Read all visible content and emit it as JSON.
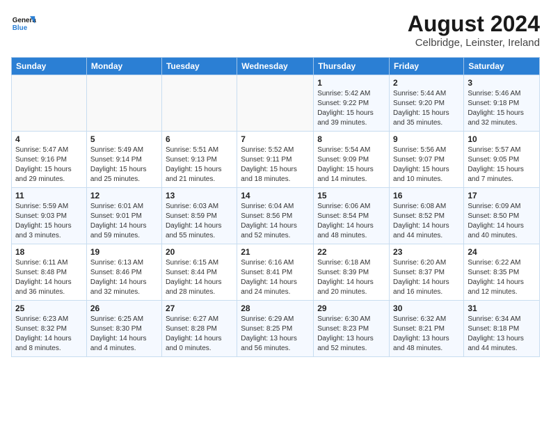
{
  "header": {
    "logo_general": "General",
    "logo_blue": "Blue",
    "month_year": "August 2024",
    "location": "Celbridge, Leinster, Ireland"
  },
  "days_of_week": [
    "Sunday",
    "Monday",
    "Tuesday",
    "Wednesday",
    "Thursday",
    "Friday",
    "Saturday"
  ],
  "weeks": [
    [
      {
        "day": "",
        "info": ""
      },
      {
        "day": "",
        "info": ""
      },
      {
        "day": "",
        "info": ""
      },
      {
        "day": "",
        "info": ""
      },
      {
        "day": "1",
        "info": "Sunrise: 5:42 AM\nSunset: 9:22 PM\nDaylight: 15 hours\nand 39 minutes."
      },
      {
        "day": "2",
        "info": "Sunrise: 5:44 AM\nSunset: 9:20 PM\nDaylight: 15 hours\nand 35 minutes."
      },
      {
        "day": "3",
        "info": "Sunrise: 5:46 AM\nSunset: 9:18 PM\nDaylight: 15 hours\nand 32 minutes."
      }
    ],
    [
      {
        "day": "4",
        "info": "Sunrise: 5:47 AM\nSunset: 9:16 PM\nDaylight: 15 hours\nand 29 minutes."
      },
      {
        "day": "5",
        "info": "Sunrise: 5:49 AM\nSunset: 9:14 PM\nDaylight: 15 hours\nand 25 minutes."
      },
      {
        "day": "6",
        "info": "Sunrise: 5:51 AM\nSunset: 9:13 PM\nDaylight: 15 hours\nand 21 minutes."
      },
      {
        "day": "7",
        "info": "Sunrise: 5:52 AM\nSunset: 9:11 PM\nDaylight: 15 hours\nand 18 minutes."
      },
      {
        "day": "8",
        "info": "Sunrise: 5:54 AM\nSunset: 9:09 PM\nDaylight: 15 hours\nand 14 minutes."
      },
      {
        "day": "9",
        "info": "Sunrise: 5:56 AM\nSunset: 9:07 PM\nDaylight: 15 hours\nand 10 minutes."
      },
      {
        "day": "10",
        "info": "Sunrise: 5:57 AM\nSunset: 9:05 PM\nDaylight: 15 hours\nand 7 minutes."
      }
    ],
    [
      {
        "day": "11",
        "info": "Sunrise: 5:59 AM\nSunset: 9:03 PM\nDaylight: 15 hours\nand 3 minutes."
      },
      {
        "day": "12",
        "info": "Sunrise: 6:01 AM\nSunset: 9:01 PM\nDaylight: 14 hours\nand 59 minutes."
      },
      {
        "day": "13",
        "info": "Sunrise: 6:03 AM\nSunset: 8:59 PM\nDaylight: 14 hours\nand 55 minutes."
      },
      {
        "day": "14",
        "info": "Sunrise: 6:04 AM\nSunset: 8:56 PM\nDaylight: 14 hours\nand 52 minutes."
      },
      {
        "day": "15",
        "info": "Sunrise: 6:06 AM\nSunset: 8:54 PM\nDaylight: 14 hours\nand 48 minutes."
      },
      {
        "day": "16",
        "info": "Sunrise: 6:08 AM\nSunset: 8:52 PM\nDaylight: 14 hours\nand 44 minutes."
      },
      {
        "day": "17",
        "info": "Sunrise: 6:09 AM\nSunset: 8:50 PM\nDaylight: 14 hours\nand 40 minutes."
      }
    ],
    [
      {
        "day": "18",
        "info": "Sunrise: 6:11 AM\nSunset: 8:48 PM\nDaylight: 14 hours\nand 36 minutes."
      },
      {
        "day": "19",
        "info": "Sunrise: 6:13 AM\nSunset: 8:46 PM\nDaylight: 14 hours\nand 32 minutes."
      },
      {
        "day": "20",
        "info": "Sunrise: 6:15 AM\nSunset: 8:44 PM\nDaylight: 14 hours\nand 28 minutes."
      },
      {
        "day": "21",
        "info": "Sunrise: 6:16 AM\nSunset: 8:41 PM\nDaylight: 14 hours\nand 24 minutes."
      },
      {
        "day": "22",
        "info": "Sunrise: 6:18 AM\nSunset: 8:39 PM\nDaylight: 14 hours\nand 20 minutes."
      },
      {
        "day": "23",
        "info": "Sunrise: 6:20 AM\nSunset: 8:37 PM\nDaylight: 14 hours\nand 16 minutes."
      },
      {
        "day": "24",
        "info": "Sunrise: 6:22 AM\nSunset: 8:35 PM\nDaylight: 14 hours\nand 12 minutes."
      }
    ],
    [
      {
        "day": "25",
        "info": "Sunrise: 6:23 AM\nSunset: 8:32 PM\nDaylight: 14 hours\nand 8 minutes."
      },
      {
        "day": "26",
        "info": "Sunrise: 6:25 AM\nSunset: 8:30 PM\nDaylight: 14 hours\nand 4 minutes."
      },
      {
        "day": "27",
        "info": "Sunrise: 6:27 AM\nSunset: 8:28 PM\nDaylight: 14 hours\nand 0 minutes."
      },
      {
        "day": "28",
        "info": "Sunrise: 6:29 AM\nSunset: 8:25 PM\nDaylight: 13 hours\nand 56 minutes."
      },
      {
        "day": "29",
        "info": "Sunrise: 6:30 AM\nSunset: 8:23 PM\nDaylight: 13 hours\nand 52 minutes."
      },
      {
        "day": "30",
        "info": "Sunrise: 6:32 AM\nSunset: 8:21 PM\nDaylight: 13 hours\nand 48 minutes."
      },
      {
        "day": "31",
        "info": "Sunrise: 6:34 AM\nSunset: 8:18 PM\nDaylight: 13 hours\nand 44 minutes."
      }
    ]
  ]
}
